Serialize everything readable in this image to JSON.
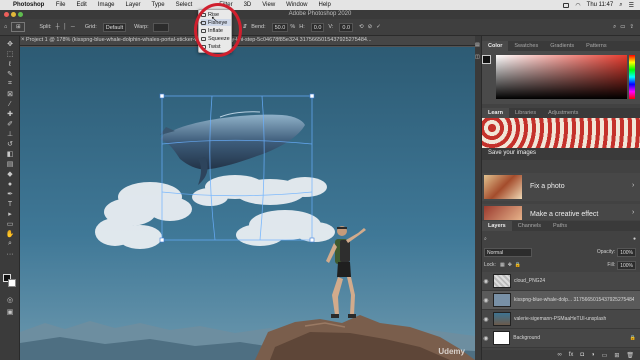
{
  "menubar": {
    "app": "Photoshop",
    "items": [
      "File",
      "Edit",
      "Image",
      "Layer",
      "Type",
      "Select",
      "Filter",
      "3D",
      "View",
      "Window",
      "Help"
    ],
    "clock": "Thu 11:47"
  },
  "window": {
    "title": "Adobe Photoshop 2020"
  },
  "options": {
    "split_label": "Split:",
    "grid_label": "Grid:",
    "grid_value": "Default",
    "warp_label": "Warp:",
    "bend_label": "Bend:",
    "bend_value": "50.0",
    "bend_unit": "%",
    "h_label": "H:",
    "h_value": "0.0",
    "v_label": "V:",
    "v_value": "0.0"
  },
  "document": {
    "tab": "Project 1 @ 178% (kisspng-blue-whale-dolphin-whales-portal-sticker-whale-sticker-by-khi-step-5c04678f85e324.3175665015437925275484..."
  },
  "warp_menu": {
    "items": [
      {
        "label": "Rise",
        "icon": "rise-icon"
      },
      {
        "label": "Fisheye",
        "icon": "fisheye-icon"
      },
      {
        "label": "Inflate",
        "icon": "inflate-icon"
      },
      {
        "label": "Squeeze",
        "icon": "squeeze-icon"
      },
      {
        "label": "Twist",
        "icon": "twist-icon"
      }
    ],
    "checked": "Fisheye"
  },
  "panels": {
    "color_tabs": [
      "Color",
      "Swatches",
      "Gradients",
      "Patterns"
    ],
    "learn_tabs": [
      "Learn",
      "Libraries",
      "Adjustments"
    ],
    "learn_banner": "Save your images",
    "learn_items": [
      "Fix a photo",
      "Make a creative effect"
    ],
    "layers_tabs": [
      "Layers",
      "Channels",
      "Paths"
    ],
    "blend_mode": "Normal",
    "opacity_label": "Opacity:",
    "opacity_value": "100%",
    "lock_label": "Lock:",
    "fill_label": "Fill:",
    "fill_value": "100%",
    "layers": [
      {
        "name": "cloud_PNG24",
        "selected": false
      },
      {
        "name": "kisspng-blue-whale-dolp... 3175665015437925275484",
        "selected": true
      },
      {
        "name": "valerie-sigemann-PSMaaHeTUI-unsplash",
        "selected": false
      },
      {
        "name": "Background",
        "selected": false
      }
    ]
  },
  "watermark": "Udemy",
  "colors": {
    "accent_red": "#d01f2e",
    "sky": "#2f5f78",
    "panel_bg": "#424242"
  }
}
